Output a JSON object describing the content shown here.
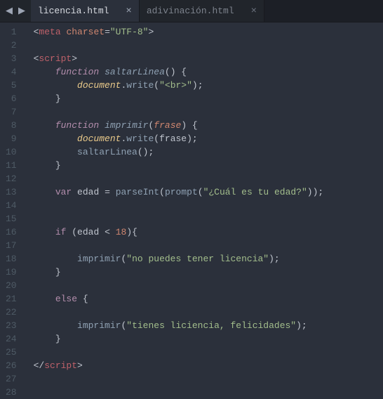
{
  "tabs": {
    "controls": {
      "left": "◀",
      "right": "▶"
    },
    "items": [
      {
        "label": "licencia.html",
        "active": true
      },
      {
        "label": "adivinación.html",
        "active": false
      }
    ]
  },
  "gutter": [
    "1",
    "2",
    "3",
    "4",
    "5",
    "6",
    "7",
    "8",
    "9",
    "10",
    "11",
    "12",
    "13",
    "14",
    "15",
    "16",
    "17",
    "18",
    "19",
    "20",
    "21",
    "22",
    "23",
    "24",
    "25",
    "26",
    "27",
    "28"
  ],
  "code": {
    "l1_tag": "meta",
    "l1_attr": "charset",
    "l1_val": "\"UTF-8\"",
    "l3_tag": "script",
    "l4_kw": "function",
    "l4_fn": "saltarLinea",
    "l5_obj": "document",
    "l5_fn": "write",
    "l5_str": "\"<br>\"",
    "l8_kw": "function",
    "l8_fn": "imprimir",
    "l8_param": "frase",
    "l9_obj": "document",
    "l9_fn": "write",
    "l9_arg": "frase",
    "l10_fn": "saltarLinea",
    "l13_kw": "var",
    "l13_var": "edad",
    "l13_fn1": "parseInt",
    "l13_fn2": "prompt",
    "l13_str": "\"¿Cuál es tu edad?\"",
    "l16_kw": "if",
    "l16_var": "edad",
    "l16_num": "18",
    "l18_fn": "imprimir",
    "l18_str": "\"no puedes tener licencia\"",
    "l21_kw": "else",
    "l23_fn": "imprimir",
    "l23_str": "\"tienes liciencia, felicidades\"",
    "l26_tag": "script"
  }
}
